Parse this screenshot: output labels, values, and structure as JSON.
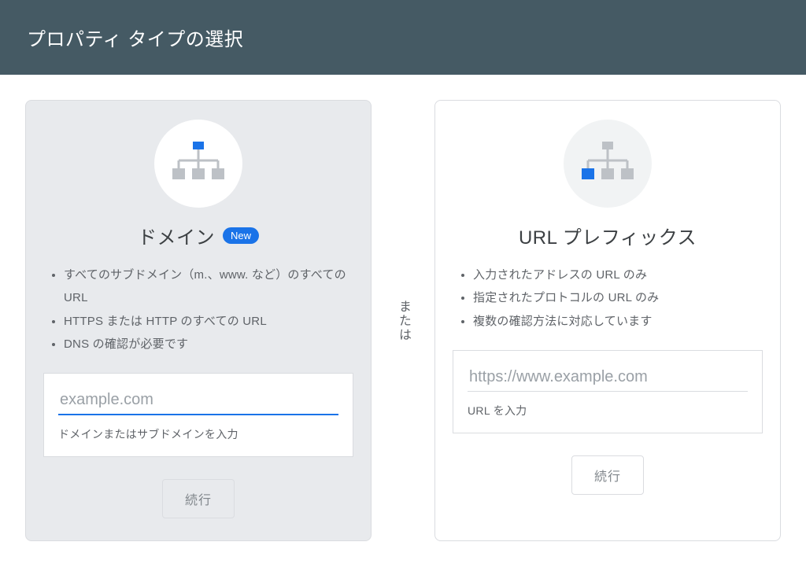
{
  "header": {
    "title": "プロパティ タイプの選択"
  },
  "separator": "または",
  "cards": {
    "domain": {
      "title": "ドメイン",
      "badge": "New",
      "bullets": [
        "すべてのサブドメイン（m.、www. など）のすべての URL",
        "HTTPS または HTTP のすべての URL",
        "DNS の確認が必要です"
      ],
      "input_placeholder": "example.com",
      "input_helper": "ドメインまたはサブドメインを入力",
      "continue": "続行"
    },
    "url_prefix": {
      "title": "URL プレフィックス",
      "bullets": [
        "入力されたアドレスの URL のみ",
        "指定されたプロトコルの URL のみ",
        "複数の確認方法に対応しています"
      ],
      "input_placeholder": "https://www.example.com",
      "input_helper": "URL を入力",
      "continue": "続行"
    }
  }
}
